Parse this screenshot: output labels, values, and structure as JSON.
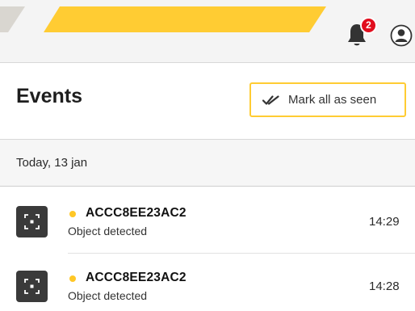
{
  "header": {
    "notification_count": "2",
    "icons": {
      "bell": "bell-icon",
      "user": "user-avatar-icon"
    },
    "colors": {
      "brand_yellow": "#ffcc33",
      "badge_red": "#e10e1e"
    }
  },
  "events": {
    "title": "Events",
    "mark_all_label": "Mark all as seen",
    "mark_all_icon": "double-check-icon"
  },
  "groups": [
    {
      "label": "Today, 13 jan",
      "items": [
        {
          "device": "ACCC8EE23AC2",
          "description": "Object detected",
          "time": "14:29",
          "status_color": "#ffc726",
          "icon": "object-detection-icon"
        },
        {
          "device": "ACCC8EE23AC2",
          "description": "Object detected",
          "time": "14:28",
          "status_color": "#ffc726",
          "icon": "object-detection-icon"
        }
      ]
    }
  ]
}
